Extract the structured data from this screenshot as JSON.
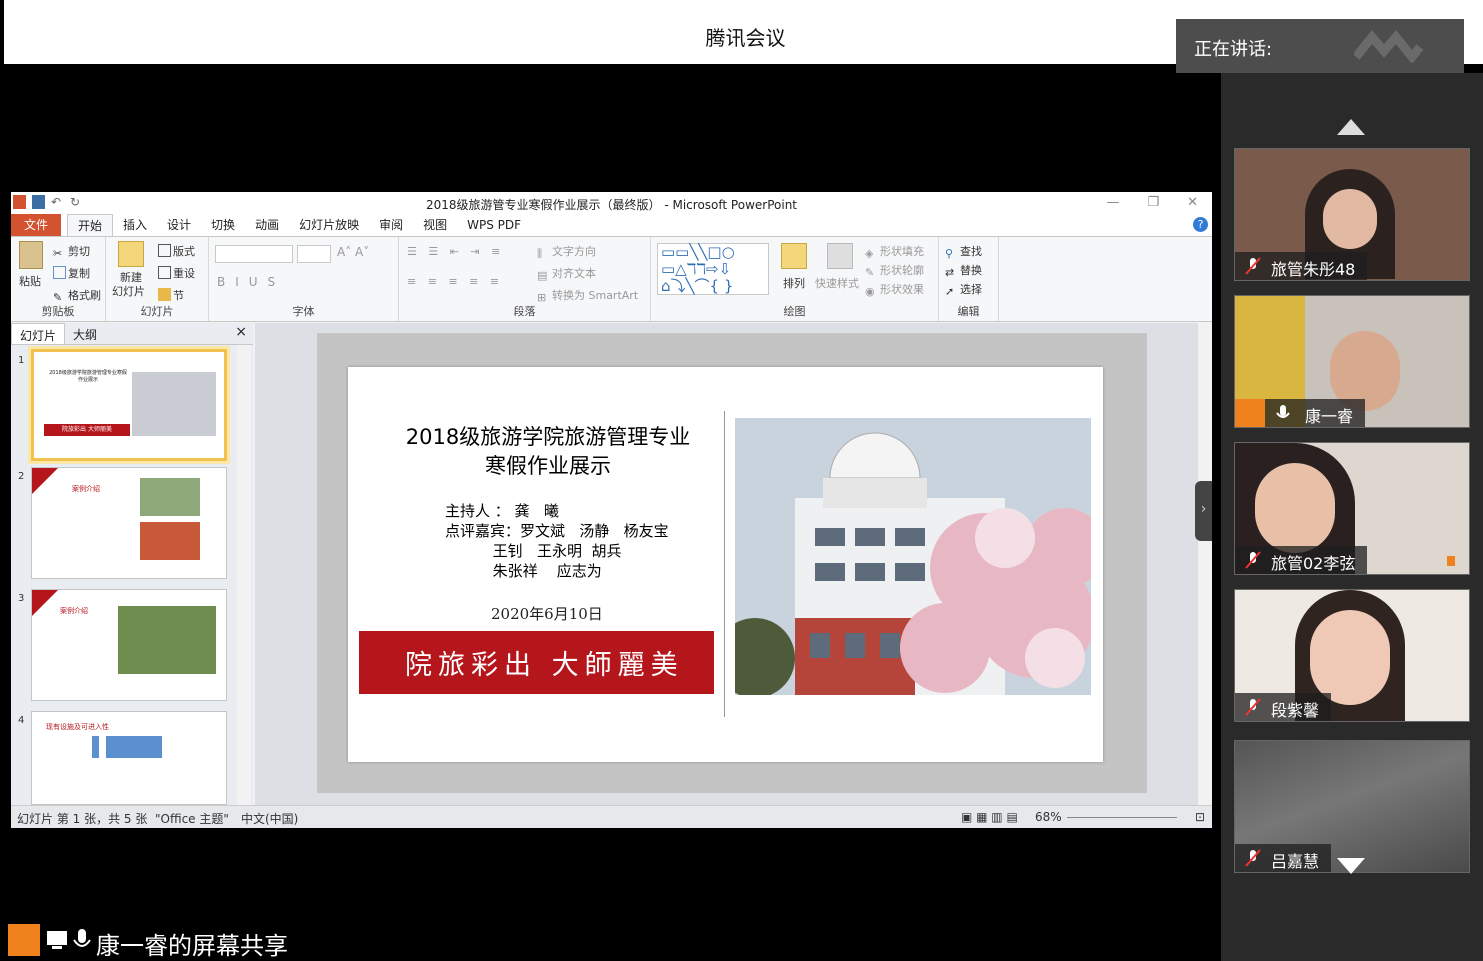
{
  "app": {
    "title": "腾讯会议",
    "speaking_label": "正在讲话:"
  },
  "ppt": {
    "window_title": "2018级旅游管专业寒假作业展示（最终版） - Microsoft PowerPoint",
    "tabs": [
      "文件",
      "开始",
      "插入",
      "设计",
      "切换",
      "动画",
      "幻灯片放映",
      "审阅",
      "视图",
      "WPS PDF"
    ],
    "active_tab": "开始",
    "ribbon": {
      "clipboard": {
        "label": "剪贴板",
        "paste": "粘贴",
        "cut": "剪切",
        "copy": "复制",
        "format_painter": "格式刷"
      },
      "slides": {
        "label": "幻灯片",
        "new_slide": "新建",
        "new_slide2": "幻灯片",
        "layout": "版式",
        "reset": "重设",
        "section": "节"
      },
      "font": {
        "label": "字体"
      },
      "paragraph": {
        "label": "段落",
        "text_direction": "文字方向",
        "align_text": "对齐文本",
        "smartart": "转换为 SmartArt"
      },
      "drawing": {
        "label": "绘图",
        "arrange": "排列",
        "quick_styles": "快速样式",
        "shape_fill": "形状填充",
        "shape_outline": "形状轮廓",
        "shape_effects": "形状效果"
      },
      "editing": {
        "label": "编辑",
        "find": "查找",
        "replace": "替换",
        "select": "选择"
      }
    },
    "panel": {
      "tab_slides": "幻灯片",
      "tab_outline": "大纲",
      "close": "×"
    },
    "thumbnails": [
      {
        "num": "1",
        "title": "2018级旅游学院旅游管理专业寒假作业展示",
        "banner": "院旅彩出 大师丽美"
      },
      {
        "num": "2",
        "title": "案例介绍"
      },
      {
        "num": "3",
        "title": "案例介绍"
      },
      {
        "num": "4",
        "title": "现有设施及可进入性"
      }
    ],
    "slide": {
      "title_line1": "2018级旅游学院旅游管理专业",
      "title_line2": "寒假作业展示",
      "host": "主持人 ： 龚   曦\n点评嘉宾：罗文斌   汤静   杨友宝\n          王钊   王永明  胡兵\n          朱张祥    应志为",
      "date": "2020年6月10日",
      "banner": "院旅彩出 大師麗美"
    },
    "status": {
      "slide_info": "幻灯片 第 1 张，共 5 张",
      "theme": "\"Office 主题\"",
      "language": "中文(中国)",
      "zoom": "68%"
    }
  },
  "participants": [
    {
      "name": "旅管朱彤48",
      "muted": true
    },
    {
      "name": "康一睿",
      "muted": false,
      "host": true
    },
    {
      "name": "旅管02李弦",
      "muted": true
    },
    {
      "name": "段紫馨",
      "muted": true
    },
    {
      "name": "吕嘉慧",
      "muted": true,
      "video": false
    }
  ],
  "share": {
    "label": "康一睿的屏幕共享"
  },
  "colors": {
    "accent": "#f0821e",
    "ppt_red": "#b5161b",
    "file_tab": "#d35230"
  }
}
